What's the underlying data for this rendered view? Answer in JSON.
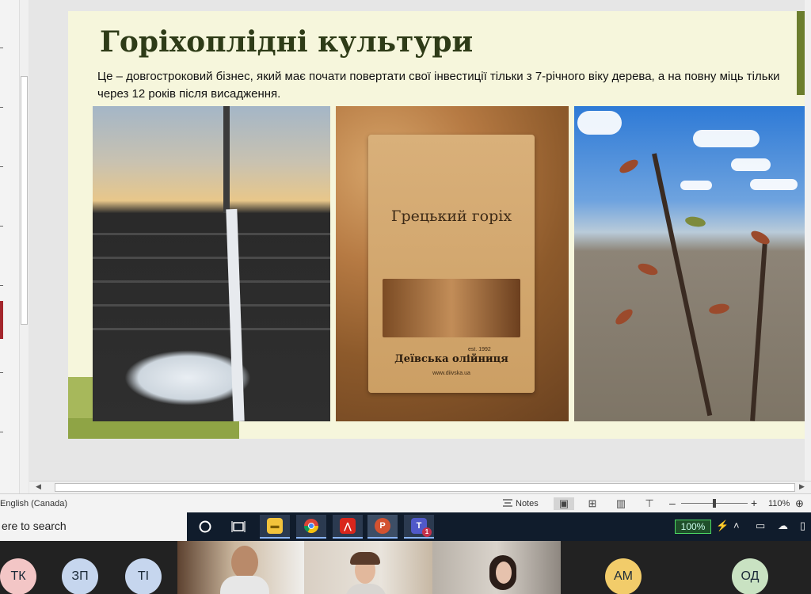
{
  "slide": {
    "title": "Горіхоплідні культури",
    "body": "Це – довгостроковий бізнес, який має почати повертати свої інвестиції тільки з 7-річного віку дерева, а на повну міць тільки через 12 років після висадження.",
    "bag_title": "Грецький горіх",
    "bag_brand": "Деївська олійниця",
    "bag_est": "est. 1992",
    "bag_url": "www.diivska.ua"
  },
  "status_bar": {
    "language": "English (Canada)",
    "notes_label": "Notes",
    "zoom_minus": "–",
    "zoom_plus": "+",
    "zoom_level": "110%"
  },
  "taskbar": {
    "search_text": "ere to search",
    "battery": "100%",
    "teams_badge": "1"
  },
  "call": {
    "participants": [
      {
        "initials": "ТК",
        "color": "#f3c6c6"
      },
      {
        "initials": "ЗП",
        "color": "#c6d6ee"
      },
      {
        "initials": "ТІ",
        "color": "#c6d6ee"
      },
      {
        "initials": "АМ",
        "color": "#f2cc6a"
      },
      {
        "initials": "ОД",
        "color": "#c9e2c2"
      }
    ]
  }
}
